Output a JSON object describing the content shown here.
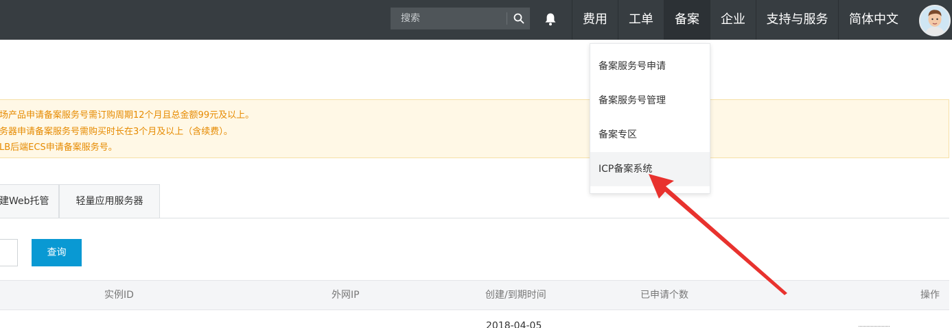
{
  "topbar": {
    "search": {
      "placeholder": "搜索"
    },
    "nav": {
      "fees": "费用",
      "tickets": "工单",
      "filing": "备案",
      "enterprise": "企业",
      "support": "支持与服务",
      "language": "简体中文"
    }
  },
  "banner": {
    "lines": [
      "场产品申请备案服务号需订购周期12个月且总金额99元及以上。",
      "务器申请备案服务号需购买时长在3个月及以上（含续费）。",
      "LB后端ECS申请备案服务号。"
    ]
  },
  "tabs": [
    "建Web托管",
    "轻量应用服务器"
  ],
  "query": {
    "button_label": "查询"
  },
  "table": {
    "headers": [
      "实例ID",
      "外网IP",
      "创建/到期时间",
      "已申请个数",
      "操作"
    ],
    "rows": [
      {
        "time": "2018-04-05"
      }
    ]
  },
  "dropdown": {
    "items": [
      "备案服务号申请",
      "备案服务号管理",
      "备案专区",
      "ICP备案系统"
    ]
  },
  "colors": {
    "topbar": "#373d41",
    "accent": "#0999d3",
    "warning_text": "#e68a00",
    "annotation_arrow": "#e8322e"
  }
}
